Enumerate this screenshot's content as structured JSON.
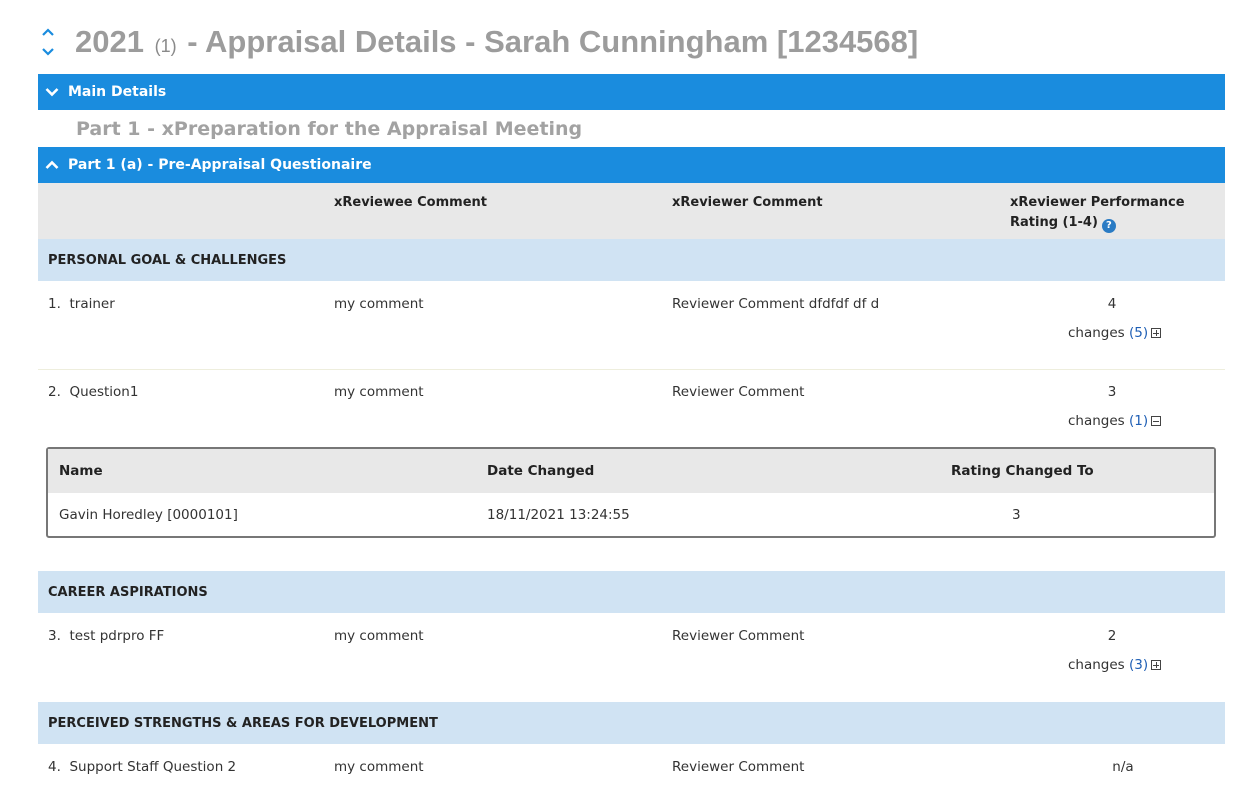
{
  "header": {
    "year": "2021",
    "count": "(1)",
    "title_rest": "- Appraisal Details - Sarah Cunningham [1234568]",
    "sort_icon": "sort-updown-icon"
  },
  "main_details": {
    "label": "Main Details",
    "state": "collapsed"
  },
  "part_heading": "Part 1 - xPreparation for the Appraisal Meeting",
  "part_1a": {
    "label": "Part 1 (a) - Pre-Appraisal Questionaire",
    "state": "expanded"
  },
  "columns": {
    "reviewee": "xReviewee Comment",
    "reviewer": "xReviewer Comment",
    "rating_line1": "xReviewer Performance",
    "rating_line2": "Rating (1-4)",
    "help": "?"
  },
  "sections": [
    {
      "title": "PERSONAL GOAL & CHALLENGES"
    },
    {
      "title": "CAREER ASPIRATIONS"
    },
    {
      "title": "PERCEIVED STRENGTHS & AREAS FOR DEVELOPMENT"
    }
  ],
  "questions": [
    {
      "number": "1.",
      "question": "trainer",
      "reviewee_comment": "my comment",
      "reviewer_comment": "Reviewer Comment dfdfdf df d",
      "rating": "4",
      "changes_label": "changes",
      "changes_count": "(5)",
      "expanded": false
    },
    {
      "number": "2.",
      "question": "Question1",
      "reviewee_comment": "my comment",
      "reviewer_comment": "Reviewer Comment",
      "rating": "3",
      "changes_label": "changes",
      "changes_count": "(1)",
      "expanded": true
    },
    {
      "number": "3.",
      "question": "test pdrpro FF",
      "reviewee_comment": "my comment",
      "reviewer_comment": "Reviewer Comment",
      "rating": "2",
      "changes_label": "changes",
      "changes_count": "(3)",
      "expanded": false
    },
    {
      "number": "4.",
      "question": "Support Staff Question 2",
      "reviewee_comment": "my comment",
      "reviewer_comment": "Reviewer Comment",
      "rating": "n/a"
    }
  ],
  "history": {
    "headers": {
      "name": "Name",
      "date": "Date Changed",
      "rating": "Rating Changed To"
    },
    "rows": [
      {
        "name": "Gavin Horedley [0000101]",
        "date": "18/11/2021 13:24:55",
        "rating": "3"
      }
    ]
  },
  "colors": {
    "bar_blue": "#1a8cde",
    "section_bg": "#d0e3f3",
    "header_bg": "#e8e8e8",
    "title_grey": "#9c9c9c",
    "link_blue": "#1f5fb5"
  }
}
